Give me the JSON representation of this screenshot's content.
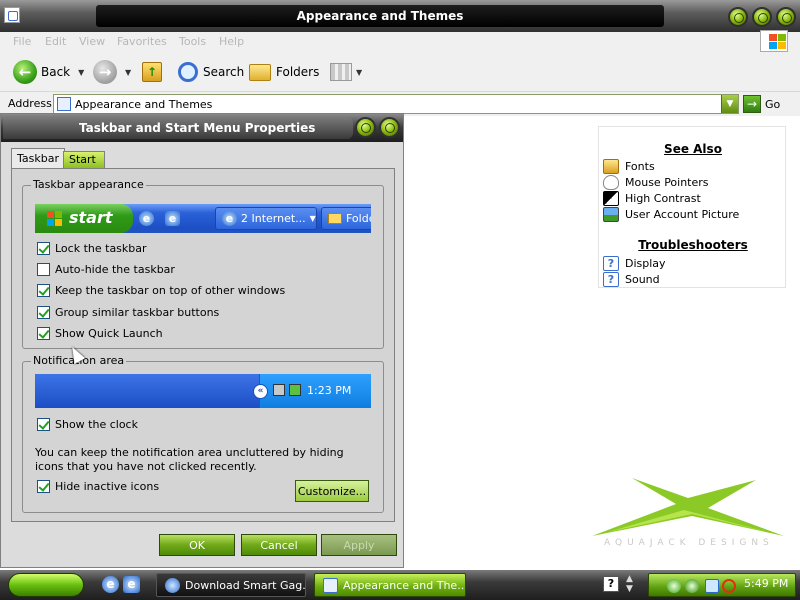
{
  "window": {
    "title": "Appearance and Themes",
    "menu": [
      "File",
      "Edit",
      "View",
      "Favorites",
      "Tools",
      "Help"
    ],
    "toolbar": {
      "back": "Back",
      "search": "Search",
      "folders": "Folders"
    },
    "address": {
      "label": "Address",
      "value": "Appearance and Themes",
      "go": "Go"
    }
  },
  "see_also": {
    "heading": "See Also",
    "items": [
      "Fonts",
      "Mouse Pointers",
      "High Contrast",
      "User Account Picture"
    ],
    "troubleshooters_heading": "Troubleshooters",
    "troubleshooters": [
      "Display",
      "Sound"
    ]
  },
  "branding": {
    "designs_text": "AQUAJACK DESIGNS"
  },
  "dialog": {
    "title": "Taskbar and Start Menu Properties",
    "tabs": [
      "Taskbar",
      "Start Menu"
    ],
    "taskbar_group": {
      "label": "Taskbar appearance",
      "preview_start": "start",
      "preview_button_1": "2 Internet...",
      "preview_button_2": "Folde",
      "options": [
        {
          "label": "Lock the taskbar",
          "checked": true
        },
        {
          "label": "Auto-hide the taskbar",
          "checked": false
        },
        {
          "label": "Keep the taskbar on top of other windows",
          "checked": true
        },
        {
          "label": "Group similar taskbar buttons",
          "checked": true
        },
        {
          "label": "Show Quick Launch",
          "checked": true
        }
      ]
    },
    "notify_group": {
      "label": "Notification area",
      "preview_time": "1:23 PM",
      "show_clock": {
        "label": "Show the clock",
        "checked": true
      },
      "description": "You can keep the notification area uncluttered by hiding icons that you have not clicked recently.",
      "hide_inactive": {
        "label": "Hide inactive icons",
        "checked": true
      },
      "customize": "Customize..."
    },
    "buttons": {
      "ok": "OK",
      "cancel": "Cancel",
      "apply": "Apply"
    }
  },
  "taskbar": {
    "tasks": [
      "Download Smart Gag...",
      "Appearance and The..."
    ],
    "clock": "5:49 PM"
  },
  "colors": {
    "accent_green": "#6fb010",
    "xp_blue": "#1c4ec4",
    "chrome_dark": "#1e1e1e"
  }
}
